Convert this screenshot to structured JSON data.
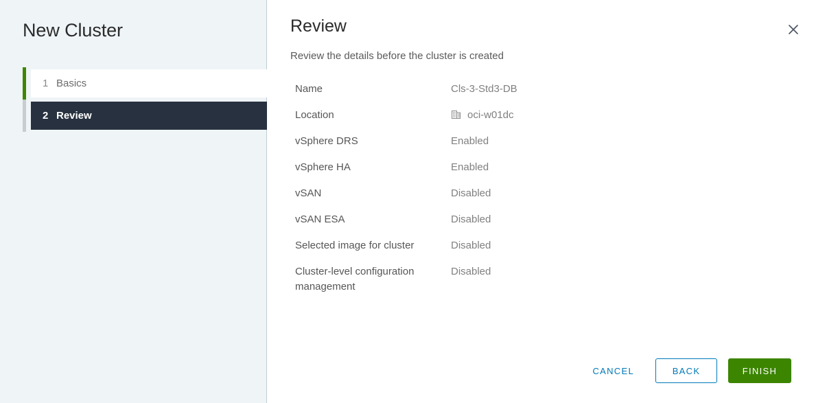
{
  "sidebar": {
    "title": "New Cluster",
    "steps": [
      {
        "number": "1",
        "label": "Basics",
        "state": "done"
      },
      {
        "number": "2",
        "label": "Review",
        "state": "active"
      }
    ]
  },
  "main": {
    "title": "Review",
    "subtitle": "Review the details before the cluster is created",
    "close_icon": "close-icon",
    "details": [
      {
        "label": "Name",
        "value": "Cls-3-Std3-DB",
        "icon": null
      },
      {
        "label": "Location",
        "value": "oci-w01dc",
        "icon": "datacenter-icon"
      },
      {
        "label": "vSphere DRS",
        "value": "Enabled",
        "icon": null
      },
      {
        "label": "vSphere HA",
        "value": "Enabled",
        "icon": null
      },
      {
        "label": "vSAN",
        "value": "Disabled",
        "icon": null
      },
      {
        "label": "vSAN ESA",
        "value": "Disabled",
        "icon": null
      },
      {
        "label": "Selected image for cluster",
        "value": "Disabled",
        "icon": null
      },
      {
        "label": "Cluster-level configuration management",
        "value": "Disabled",
        "icon": null
      }
    ]
  },
  "footer": {
    "cancel_label": "CANCEL",
    "back_label": "BACK",
    "finish_label": "FINISH"
  },
  "colors": {
    "sidebar_bg": "#eff4f7",
    "step_done_bar": "#3f8600",
    "step_pending_bar": "#c8cdd0",
    "step_active_bg": "#28313f",
    "accent_blue": "#0079b8",
    "accent_green": "#3c8500",
    "divider": "#c2cdd4"
  }
}
